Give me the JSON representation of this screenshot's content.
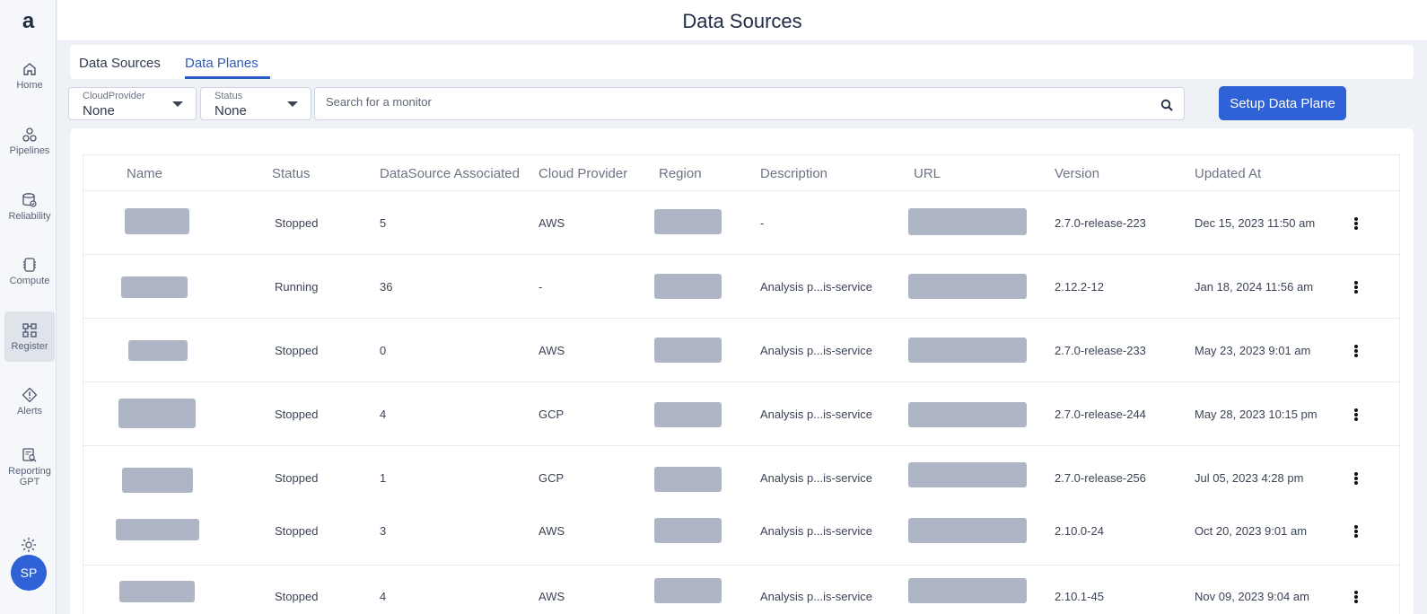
{
  "app": {
    "logo": "a"
  },
  "sidebar": {
    "items": [
      {
        "label": "Home",
        "icon": "home-icon"
      },
      {
        "label": "Pipelines",
        "icon": "pipelines-icon"
      },
      {
        "label": "Reliability",
        "icon": "database-check-icon"
      },
      {
        "label": "Compute",
        "icon": "chip-icon"
      },
      {
        "label": "Register",
        "icon": "register-icon",
        "active": true
      },
      {
        "label": "Alerts",
        "icon": "alert-icon"
      },
      {
        "label": "Reporting GPT",
        "icon": "report-search-icon"
      }
    ],
    "settings_icon": "gear-icon",
    "avatar": "SP"
  },
  "header": {
    "title": "Data Sources"
  },
  "tabs": [
    {
      "label": "Data Sources",
      "active": false
    },
    {
      "label": "Data Planes",
      "active": true
    }
  ],
  "filters": {
    "cloud_provider": {
      "label": "CloudProvider",
      "value": "None"
    },
    "status": {
      "label": "Status",
      "value": "None"
    },
    "search": {
      "placeholder": "Search for a monitor"
    }
  },
  "actions": {
    "setup_label": "Setup Data Plane"
  },
  "table": {
    "columns": [
      "Name",
      "Status",
      "DataSource Associated",
      "Cloud Provider",
      "Region",
      "Description",
      "URL",
      "Version",
      "Updated At"
    ],
    "rows": [
      {
        "status": "Stopped",
        "datasources": "5",
        "cloud": "AWS",
        "description": "-",
        "version": "2.7.0-release-223",
        "updated": "Dec 15, 2023 11:50 am"
      },
      {
        "status": "Running",
        "datasources": "36",
        "cloud": "-",
        "description": "Analysis p...is-service",
        "version": "2.12.2-12",
        "updated": "Jan 18, 2024 11:56 am"
      },
      {
        "status": "Stopped",
        "datasources": "0",
        "cloud": "AWS",
        "description": "Analysis p...is-service",
        "version": "2.7.0-release-233",
        "updated": "May 23, 2023 9:01 am"
      },
      {
        "status": "Stopped",
        "datasources": "4",
        "cloud": "GCP",
        "description": "Analysis p...is-service",
        "version": "2.7.0-release-244",
        "updated": "May 28, 2023 10:15 pm"
      },
      {
        "status": "Stopped",
        "datasources": "1",
        "cloud": "GCP",
        "description": "Analysis p...is-service",
        "version": "2.7.0-release-256",
        "updated": "Jul 05, 2023 4:28 pm"
      },
      {
        "status": "Stopped",
        "datasources": "3",
        "cloud": "AWS",
        "description": "Analysis p...is-service",
        "version": "2.10.0-24",
        "updated": "Oct 20, 2023 9:01 am"
      },
      {
        "status": "Stopped",
        "datasources": "4",
        "cloud": "AWS",
        "description": "Analysis p...is-service",
        "version": "2.10.1-45",
        "updated": "Nov 09, 2023 9:04 am"
      }
    ]
  }
}
